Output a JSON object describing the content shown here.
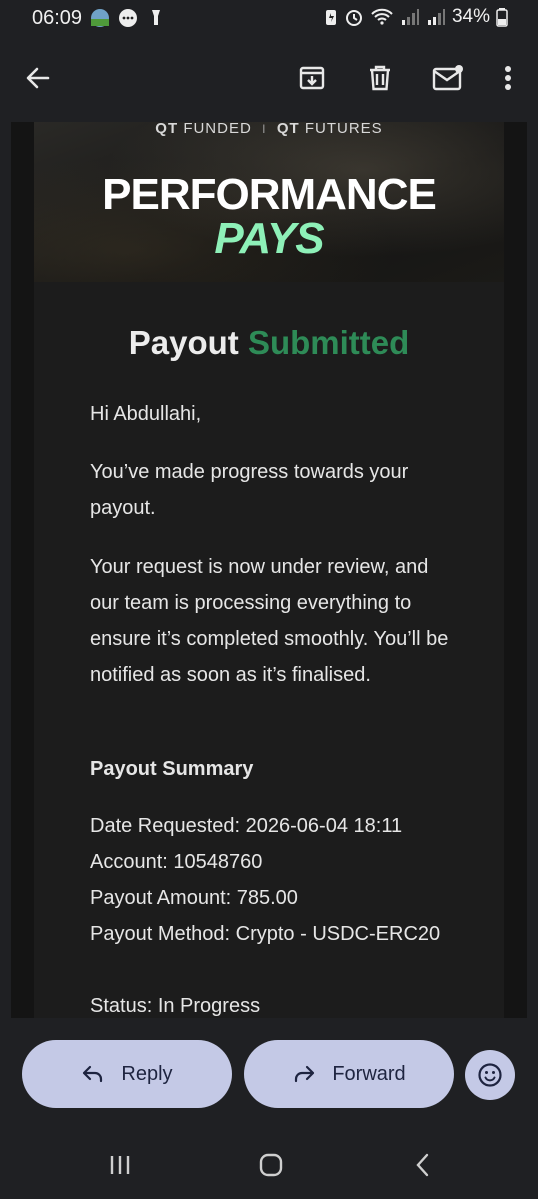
{
  "status_bar": {
    "time": "06:09",
    "battery": "34%",
    "icons": [
      "soccer-icon",
      "chat-icon",
      "flashlight-icon",
      "battery-saver-icon",
      "alarm-icon",
      "wifi-icon",
      "signal-icon",
      "signal-icon",
      "battery-icon"
    ]
  },
  "app_bar": {
    "icons": [
      "back-arrow-icon",
      "archive-icon",
      "delete-icon",
      "mark-unread-icon",
      "more-icon"
    ]
  },
  "email": {
    "banner": {
      "brand_left": "QT",
      "brand_left_text": "FUNDED",
      "separator": "I",
      "brand_right": "QT",
      "brand_right_text": "FUTURES",
      "title": "PERFORMANCE",
      "subtitle": "PAYS"
    },
    "heading_main": "Payout",
    "heading_accent": "Submitted",
    "greeting": "Hi Abdullahi,",
    "para1": "You’ve made progress towards your payout.",
    "para2": "Your request is now under review, and our team is processing everything to ensure it’s completed smoothly. You’ll be notified as soon as it’s finalised.",
    "summary_title": "Payout Summary",
    "summary": {
      "date_requested": "Date Requested: 2026-06-04 18:11",
      "account": "Account: 10548760",
      "amount": "Payout Amount: 785.00",
      "method": "Payout Method: Crypto - USDC-ERC20",
      "status": "Status: In Progress"
    }
  },
  "actions": {
    "reply": "Reply",
    "forward": "Forward"
  },
  "colors": {
    "accent_green": "#2e8b57",
    "banner_green": "#8ef0b8",
    "pill_bg": "#c4c9e6"
  }
}
